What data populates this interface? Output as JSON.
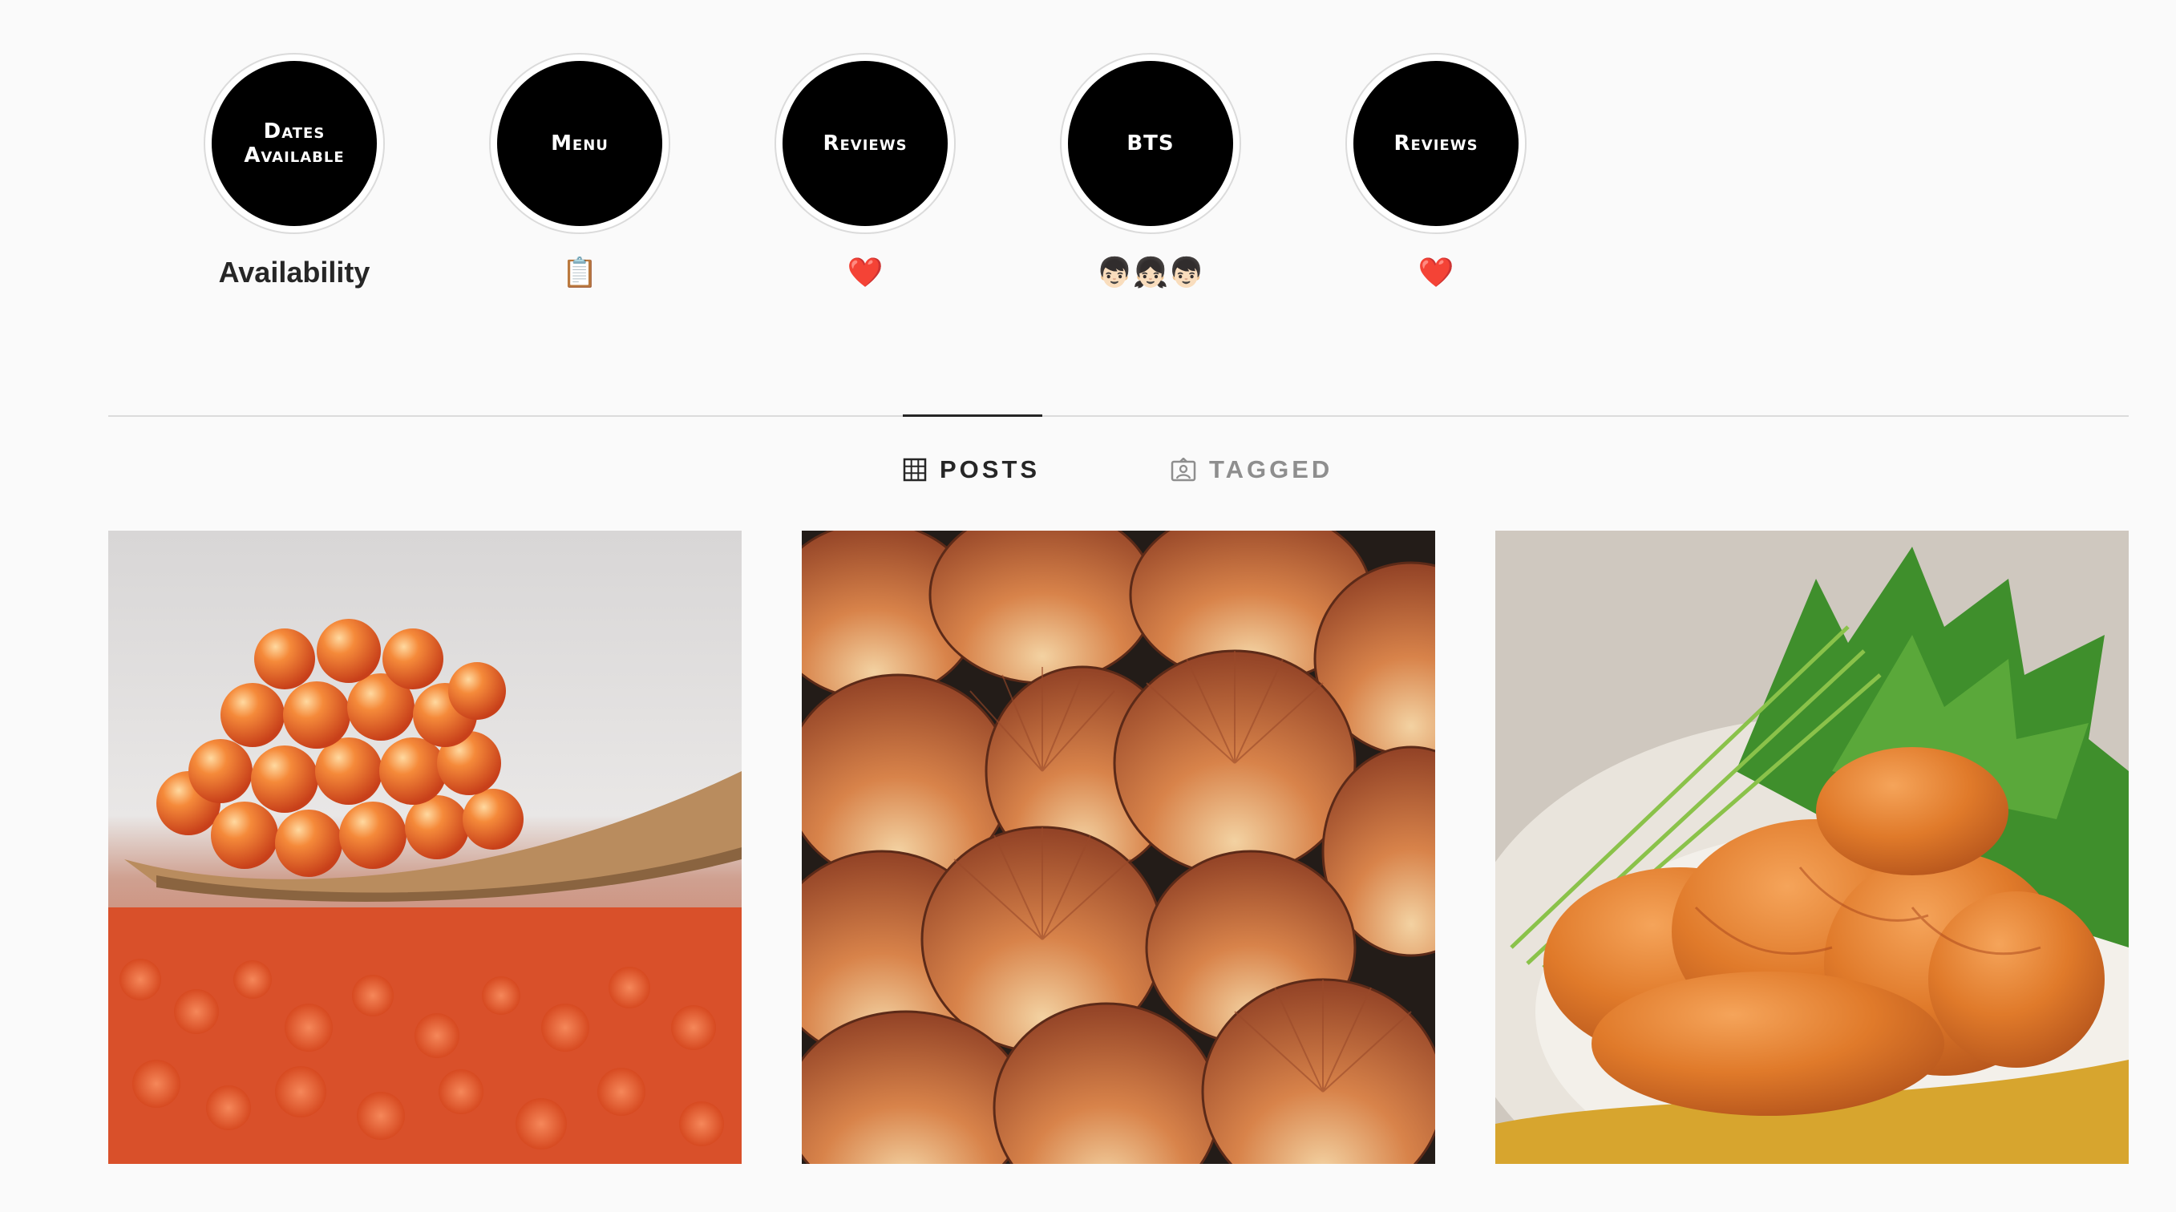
{
  "highlights": [
    {
      "cover_text": "Dates\nAvailable",
      "label": "Availability",
      "icon": "dates-available"
    },
    {
      "cover_text": "Menu",
      "label": "📋",
      "icon": "menu"
    },
    {
      "cover_text": "Reviews",
      "label": "❤️",
      "icon": "reviews"
    },
    {
      "cover_text": "BTS",
      "label": "👦🏻👧🏻👦🏻",
      "icon": "bts"
    },
    {
      "cover_text": "Reviews",
      "label": "❤️",
      "icon": "reviews"
    }
  ],
  "tabs": {
    "posts_label": "POSTS",
    "tagged_label": "TAGGED",
    "active": "posts"
  },
  "posts": [
    {
      "subject": "salmon-roe-ikura"
    },
    {
      "subject": "scallop-shells"
    },
    {
      "subject": "sea-urchin-uni"
    }
  ],
  "colors": {
    "background": "#fafafa",
    "divider": "#dbdbdb",
    "text_primary": "#262626",
    "text_secondary": "#8e8e8e",
    "highlight_cover": "#000000"
  }
}
